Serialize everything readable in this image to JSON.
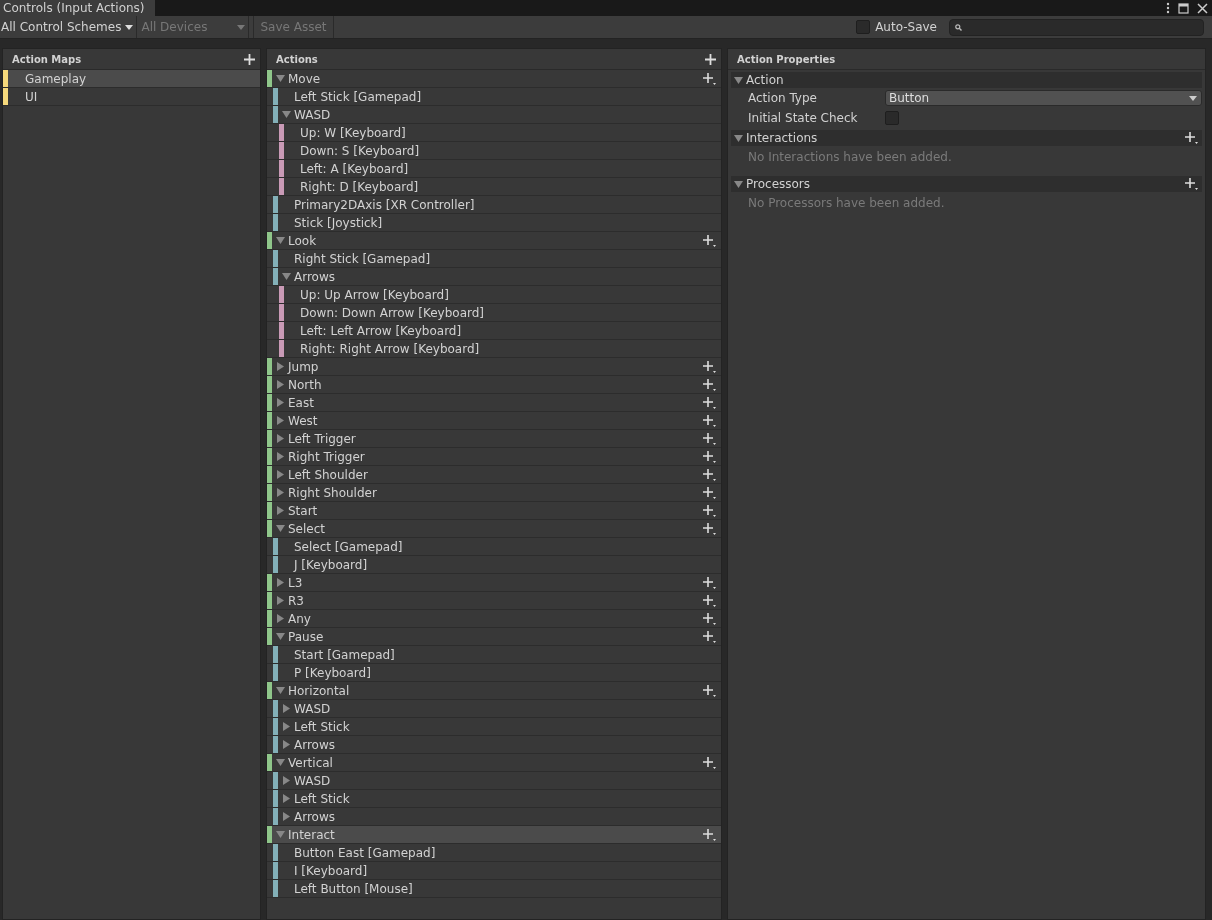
{
  "window": {
    "title": "Controls (Input Actions)"
  },
  "toolbar": {
    "control_scheme": "All Control Schemes",
    "devices": {
      "label": "All Devices",
      "disabled": true
    },
    "save_asset": {
      "label": "Save Asset",
      "disabled": true
    },
    "auto_save": {
      "label": "Auto-Save",
      "checked": false
    }
  },
  "action_maps": {
    "title": "Action Maps",
    "items": [
      {
        "label": "Gameplay",
        "selected": true
      },
      {
        "label": "UI",
        "selected": false
      }
    ]
  },
  "actions": {
    "title": "Actions",
    "items": [
      {
        "kind": "action",
        "label": "Move",
        "expanded": true,
        "selected": false,
        "children": [
          {
            "kind": "binding",
            "label": "Left Stick [Gamepad]",
            "selected": false
          },
          {
            "kind": "composite",
            "label": "WASD",
            "expanded": true,
            "selected": false,
            "children": [
              {
                "kind": "part",
                "label": "Up: W [Keyboard]",
                "selected": false
              },
              {
                "kind": "part",
                "label": "Down: S [Keyboard]",
                "selected": false
              },
              {
                "kind": "part",
                "label": "Left: A [Keyboard]",
                "selected": false
              },
              {
                "kind": "part",
                "label": "Right: D [Keyboard]",
                "selected": false
              }
            ]
          },
          {
            "kind": "binding",
            "label": "Primary2DAxis [XR Controller]",
            "selected": false
          },
          {
            "kind": "binding",
            "label": "Stick [Joystick]",
            "selected": false
          }
        ]
      },
      {
        "kind": "action",
        "label": "Look",
        "expanded": true,
        "selected": false,
        "children": [
          {
            "kind": "binding",
            "label": "Right Stick [Gamepad]",
            "selected": false
          },
          {
            "kind": "composite",
            "label": "Arrows",
            "expanded": true,
            "selected": false,
            "children": [
              {
                "kind": "part",
                "label": "Up: Up Arrow [Keyboard]",
                "selected": false
              },
              {
                "kind": "part",
                "label": "Down: Down Arrow [Keyboard]",
                "selected": false
              },
              {
                "kind": "part",
                "label": "Left: Left Arrow [Keyboard]",
                "selected": false
              },
              {
                "kind": "part",
                "label": "Right: Right Arrow [Keyboard]",
                "selected": false
              }
            ]
          }
        ]
      },
      {
        "kind": "action",
        "label": "Jump",
        "expanded": false,
        "selected": false
      },
      {
        "kind": "action",
        "label": "North",
        "expanded": false,
        "selected": false
      },
      {
        "kind": "action",
        "label": "East",
        "expanded": false,
        "selected": false
      },
      {
        "kind": "action",
        "label": "West",
        "expanded": false,
        "selected": false
      },
      {
        "kind": "action",
        "label": "Left Trigger",
        "expanded": false,
        "selected": false
      },
      {
        "kind": "action",
        "label": "Right Trigger",
        "expanded": false,
        "selected": false
      },
      {
        "kind": "action",
        "label": "Left Shoulder",
        "expanded": false,
        "selected": false
      },
      {
        "kind": "action",
        "label": "Right Shoulder",
        "expanded": false,
        "selected": false
      },
      {
        "kind": "action",
        "label": "Start",
        "expanded": false,
        "selected": false
      },
      {
        "kind": "action",
        "label": "Select",
        "expanded": true,
        "selected": false,
        "children": [
          {
            "kind": "binding",
            "label": "Select [Gamepad]",
            "selected": false
          },
          {
            "kind": "binding",
            "label": "J [Keyboard]",
            "selected": false
          }
        ]
      },
      {
        "kind": "action",
        "label": "L3",
        "expanded": false,
        "selected": false
      },
      {
        "kind": "action",
        "label": "R3",
        "expanded": false,
        "selected": false
      },
      {
        "kind": "action",
        "label": "Any",
        "expanded": false,
        "selected": false
      },
      {
        "kind": "action",
        "label": "Pause",
        "expanded": true,
        "selected": false,
        "children": [
          {
            "kind": "binding",
            "label": "Start [Gamepad]",
            "selected": false
          },
          {
            "kind": "binding",
            "label": "P [Keyboard]",
            "selected": false
          }
        ]
      },
      {
        "kind": "action",
        "label": "Horizontal",
        "expanded": true,
        "selected": false,
        "children": [
          {
            "kind": "composite",
            "label": "WASD",
            "expanded": false,
            "selected": false
          },
          {
            "kind": "composite",
            "label": "Left Stick",
            "expanded": false,
            "selected": false
          },
          {
            "kind": "composite",
            "label": "Arrows",
            "expanded": false,
            "selected": false
          }
        ]
      },
      {
        "kind": "action",
        "label": "Vertical",
        "expanded": true,
        "selected": false,
        "children": [
          {
            "kind": "composite",
            "label": "WASD",
            "expanded": false,
            "selected": false
          },
          {
            "kind": "composite",
            "label": "Left Stick",
            "expanded": false,
            "selected": false
          },
          {
            "kind": "composite",
            "label": "Arrows",
            "expanded": false,
            "selected": false
          }
        ]
      },
      {
        "kind": "action",
        "label": "Interact",
        "expanded": true,
        "selected": true,
        "children": [
          {
            "kind": "binding",
            "label": "Button East [Gamepad]",
            "selected": false
          },
          {
            "kind": "binding",
            "label": "I [Keyboard]",
            "selected": false
          },
          {
            "kind": "binding",
            "label": "Left Button [Mouse]",
            "selected": false
          }
        ]
      }
    ]
  },
  "properties": {
    "title": "Action Properties",
    "sections": [
      {
        "title": "Action",
        "expanded": true,
        "fields": [
          {
            "kind": "dropdown",
            "label": "Action Type",
            "value": "Button"
          },
          {
            "kind": "checkbox",
            "label": "Initial State Check",
            "checked": false
          }
        ]
      },
      {
        "title": "Interactions",
        "expanded": true,
        "addable": true,
        "empty_text": "No Interactions have been added."
      },
      {
        "title": "Processors",
        "expanded": true,
        "addable": true,
        "empty_text": "No Processors have been added."
      }
    ]
  }
}
